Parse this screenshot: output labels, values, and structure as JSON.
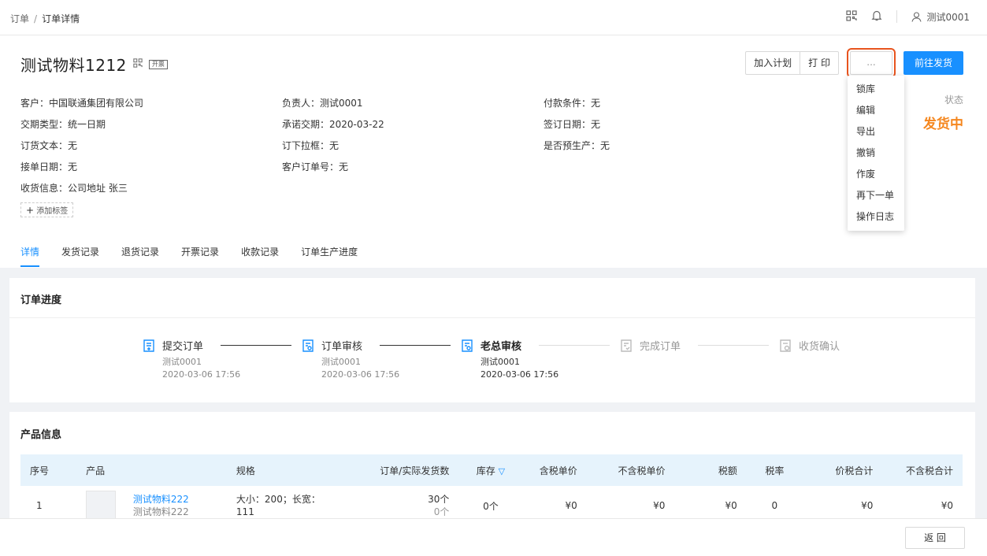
{
  "breadcrumb": {
    "parent": "订单",
    "sep": "/",
    "current": "订单详情"
  },
  "header": {
    "user": "测试0001"
  },
  "order": {
    "title": "测试物料1212",
    "invoice_tag": "开票"
  },
  "actions": {
    "add_plan": "加入计划",
    "print": "打 印",
    "more": "...",
    "ship": "前往发货"
  },
  "dropdown": [
    "锁库",
    "编辑",
    "导出",
    "撤销",
    "作废",
    "再下一单",
    "操作日志"
  ],
  "info": {
    "col1": [
      "客户：中国联通集团有限公司",
      "交期类型：统一日期",
      "订货文本：无",
      "接单日期：无",
      "收货信息：公司地址 张三"
    ],
    "col2": [
      "负责人：测试0001",
      "承诺交期：2020-03-22",
      "订下拉框：无",
      "客户订单号：无"
    ],
    "col3": [
      "付款条件：无",
      "签订日期：无",
      "是否预生产：无"
    ]
  },
  "status": {
    "label": "状态",
    "value": "发货中",
    "color": "#f5871f"
  },
  "add_tag": "添加标签",
  "tabs": [
    "详情",
    "发货记录",
    "退货记录",
    "开票记录",
    "收款记录",
    "订单生产进度"
  ],
  "progress": {
    "title": "订单进度",
    "steps": [
      {
        "label": "提交订单",
        "user": "测试0001",
        "time": "2020-03-06 17:56",
        "state": "done"
      },
      {
        "label": "订单审核",
        "user": "测试0001",
        "time": "2020-03-06 17:56",
        "state": "done"
      },
      {
        "label": "老总审核",
        "user": "测试0001",
        "time": "2020-03-06 17:56",
        "state": "current"
      },
      {
        "label": "完成订单",
        "user": "",
        "time": "",
        "state": "todo"
      },
      {
        "label": "收货确认",
        "user": "",
        "time": "",
        "state": "todo"
      }
    ]
  },
  "products": {
    "title": "产品信息",
    "headers": [
      "序号",
      "产品",
      "规格",
      "订单/实际发货数",
      "库存",
      "含税单价",
      "不含税单价",
      "税额",
      "税率",
      "价税合计",
      "不含税合计"
    ],
    "row": {
      "no": "1",
      "name": "测试物料222",
      "name2": "测试物料222",
      "spec": "大小：200；长宽：111",
      "qty": "30个",
      "shipped": "0个",
      "stock": "0个",
      "price_tax": "¥0",
      "price_notax": "¥0",
      "tax": "¥0",
      "rate": "0",
      "total_tax": "¥0",
      "total_notax": "¥0"
    }
  },
  "footer": {
    "back": "返 回"
  },
  "colors": {
    "primary": "#1890ff",
    "highlight": "#e8541e"
  }
}
